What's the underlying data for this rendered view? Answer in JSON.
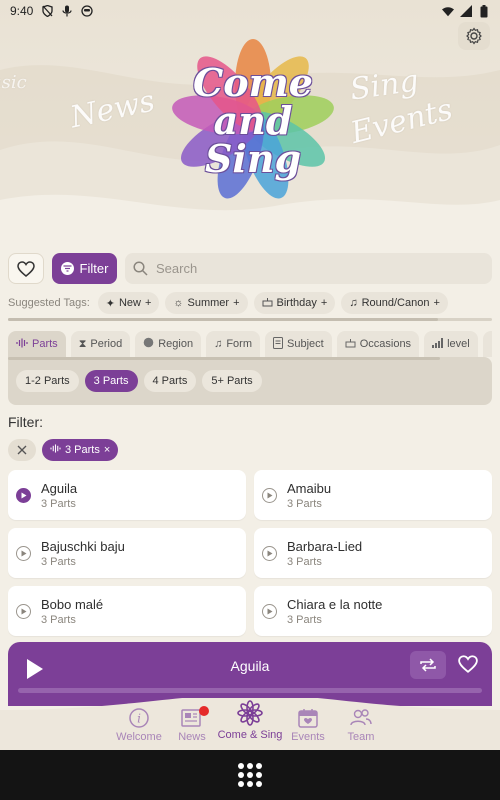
{
  "status_bar": {
    "time": "9:40"
  },
  "hero": {
    "logo_lines": [
      "Come",
      "and",
      "Sing"
    ],
    "word_news": "News",
    "word_sing": "Sing",
    "word_events": "Events",
    "word_left": "usic"
  },
  "toolbar": {
    "filter_label": "Filter",
    "search_placeholder": "Search"
  },
  "suggested_tags": {
    "label": "Suggested Tags:",
    "items": [
      {
        "label": "New",
        "icon": "sparkle-icon"
      },
      {
        "label": "Summer",
        "icon": "sun-icon"
      },
      {
        "label": "Birthday",
        "icon": "cake-icon"
      },
      {
        "label": "Round/Canon",
        "icon": "music-list-icon"
      }
    ]
  },
  "category_tabs": [
    {
      "label": "Parts",
      "icon": "waveform-icon",
      "active": true
    },
    {
      "label": "Period",
      "icon": "hourglass-icon"
    },
    {
      "label": "Region",
      "icon": "globe-icon"
    },
    {
      "label": "Form",
      "icon": "music-list-icon"
    },
    {
      "label": "Subject",
      "icon": "document-icon"
    },
    {
      "label": "Occasions",
      "icon": "cake-icon"
    },
    {
      "label": "level",
      "icon": "bars-icon"
    }
  ],
  "parts_options": [
    "1-2 Parts",
    "3 Parts",
    "4 Parts",
    "5+ Parts"
  ],
  "filter": {
    "label": "Filter:",
    "active_chip": "3 Parts"
  },
  "songs": [
    {
      "title": "Aguila",
      "parts": "3 Parts",
      "playing": true
    },
    {
      "title": "Amaibu",
      "parts": "3 Parts"
    },
    {
      "title": "Bajuschki baju",
      "parts": "3 Parts"
    },
    {
      "title": "Barbara-Lied",
      "parts": "3 Parts"
    },
    {
      "title": "Bobo malé",
      "parts": "3 Parts"
    },
    {
      "title": "Chiara e la notte",
      "parts": "3 Parts"
    }
  ],
  "player": {
    "title": "Aguila"
  },
  "bottom_nav": [
    {
      "label": "Welcome",
      "icon": "info-icon"
    },
    {
      "label": "News",
      "icon": "newspaper-icon",
      "badge": true
    },
    {
      "label": "Come & Sing",
      "icon": "flower-icon",
      "active": true
    },
    {
      "label": "Events",
      "icon": "calendar-icon"
    },
    {
      "label": "Team",
      "icon": "people-icon"
    }
  ],
  "colors": {
    "accent": "#7c3f97",
    "background": "#f3efe6",
    "badge": "#e52a2a"
  }
}
